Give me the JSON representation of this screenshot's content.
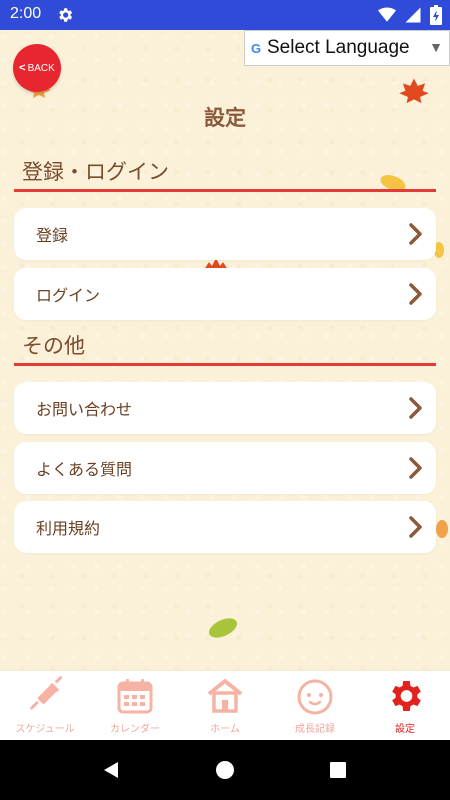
{
  "statusbar": {
    "time": "2:00"
  },
  "header": {
    "back_label": "BACK",
    "language_label": "Select Language",
    "language_arrow": "▼",
    "title": "設定"
  },
  "sections": [
    {
      "heading": "登録・ログイン",
      "items": [
        "登録",
        "ログイン"
      ]
    },
    {
      "heading": "その他",
      "items": [
        "お問い合わせ",
        "よくある質問",
        "利用規約"
      ]
    }
  ],
  "bottom_nav": [
    {
      "label": "スケジュール",
      "icon": "syringe-icon"
    },
    {
      "label": "カレンダー",
      "icon": "calendar-icon"
    },
    {
      "label": "ホーム",
      "icon": "home-icon"
    },
    {
      "label": "成長記録",
      "icon": "baby-face-icon"
    },
    {
      "label": "設定",
      "icon": "gear-icon",
      "active": true
    }
  ],
  "colors": {
    "accent": "#e43b39",
    "text_brown": "#6b3f21",
    "background": "#fbf1d9",
    "statusbar": "#2f4bd8"
  }
}
